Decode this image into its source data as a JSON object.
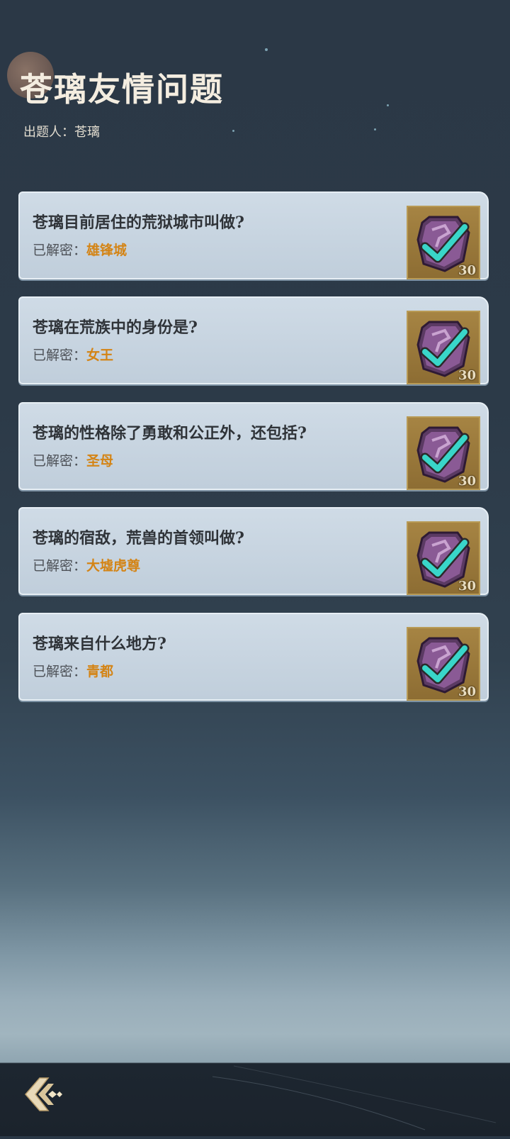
{
  "page": {
    "title": "苍璃友情问题",
    "setter": "出题人：苍璃"
  },
  "questions": [
    {
      "question": "苍璃目前居住的荒狱城市叫做?",
      "answer_label": "已解密：",
      "answer": "雄锋城",
      "reward": "30"
    },
    {
      "question": "苍璃在荒族中的身份是?",
      "answer_label": "已解密：",
      "answer": "女王",
      "reward": "30"
    },
    {
      "question": "苍璃的性格除了勇敢和公正外，还包括?",
      "answer_label": "已解密：",
      "answer": "圣母",
      "reward": "30"
    },
    {
      "question": "苍璃的宿敌，荒兽的首领叫做?",
      "answer_label": "已解密：",
      "answer": "大墟虎尊",
      "reward": "30"
    },
    {
      "question": "苍璃来自什么地方?",
      "answer_label": "已解密：",
      "answer": "青都",
      "reward": "30"
    }
  ],
  "icons": {
    "reward": "purple-badge-check-icon",
    "back": "back-arrow-icon"
  },
  "colors": {
    "answer": "#d48415",
    "card": "#c7d4e0",
    "check": "#39d6c9"
  }
}
